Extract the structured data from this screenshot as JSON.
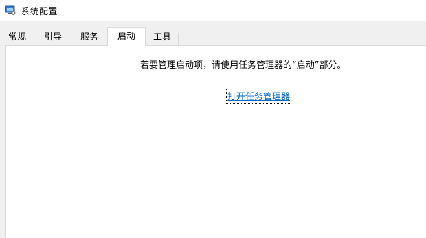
{
  "window": {
    "title": "系统配置",
    "icon": "system-config-icon"
  },
  "tabs": [
    {
      "label": "常规",
      "active": false
    },
    {
      "label": "引导",
      "active": false
    },
    {
      "label": "服务",
      "active": false
    },
    {
      "label": "启动",
      "active": true
    },
    {
      "label": "工具",
      "active": false
    }
  ],
  "startup": {
    "message": "若要管理启动项，请使用任务管理器的“启动”部分。",
    "open_task_manager_link": "打开任务管理器"
  },
  "colors": {
    "link": "#0066cc",
    "tab_border": "#d9d9d9",
    "background": "#f0f0f0"
  }
}
